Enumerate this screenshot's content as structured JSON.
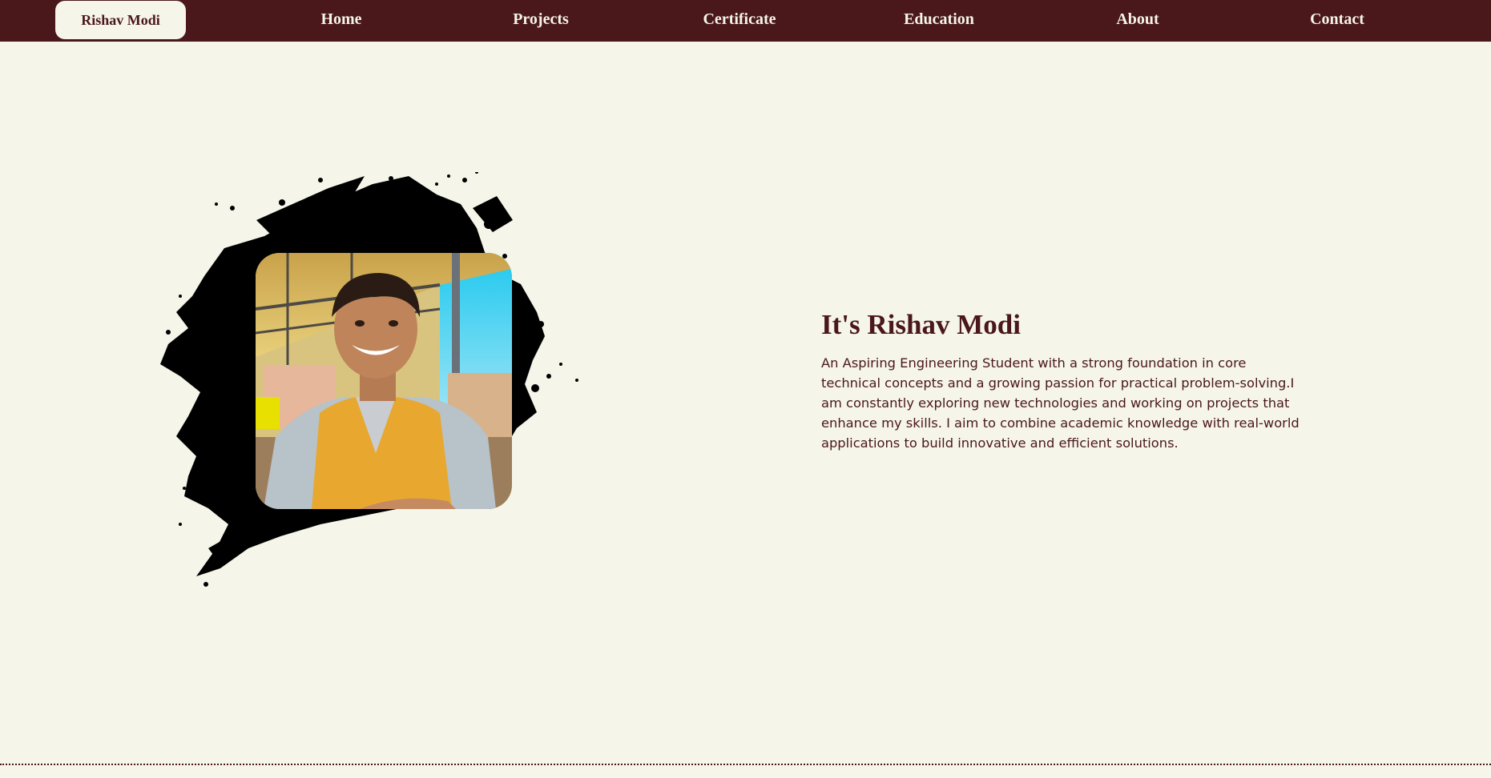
{
  "nav": {
    "brand": "Rishav Modi",
    "links": [
      "Home",
      "Projects",
      "Certificate",
      "Education",
      "About",
      "Contact"
    ]
  },
  "hero": {
    "title": "It's Rishav Modi",
    "description": "An Aspiring Engineering Student with a strong foundation in core technical concepts and a growing passion for practical problem-solving.I am constantly exploring new technologies and working on projects that enhance my skills. I aim to combine academic knowledge with real-world applications to build innovative and efficient solutions.",
    "photo_description": "Portrait photo of a smiling person wearing a yellow Academy vest over a grey t-shirt"
  },
  "colors": {
    "primary": "#4a171b",
    "background": "#f5f5e9",
    "splash": "#000000"
  }
}
